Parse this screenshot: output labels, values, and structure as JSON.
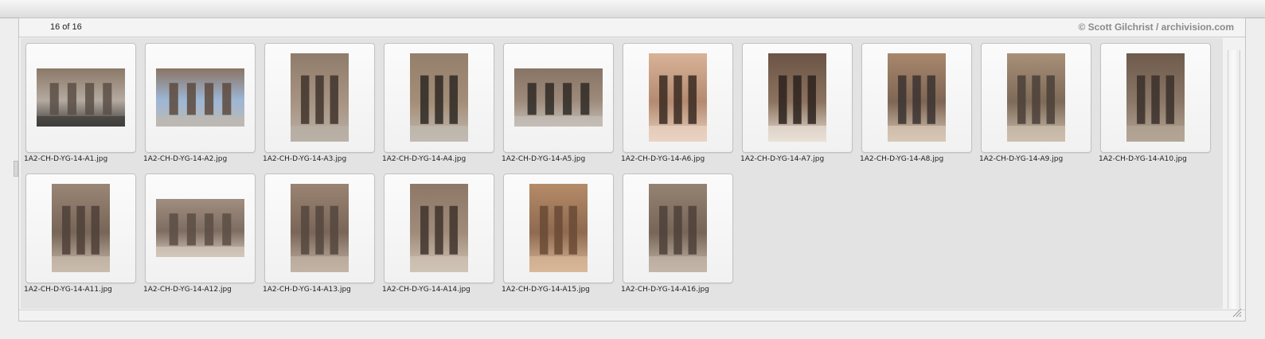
{
  "viewer": {
    "count_label": "16 of 16",
    "credit": "© Scott Gilchrist / archivision.com"
  },
  "thumbnails": [
    {
      "filename": "1A2-CH-D-YG-14-A1.jpg",
      "orientation": "landscape",
      "subject": "stone-stele-sign",
      "colors": [
        "#8b7868",
        "#5a4f47",
        "#3e3d3b",
        "#b4aaa0"
      ]
    },
    {
      "filename": "1A2-CH-D-YG-14-A2.jpg",
      "orientation": "landscape",
      "subject": "cliff-caves-with-visitors",
      "colors": [
        "#8a7464",
        "#5d4a3d",
        "#bdb8b2",
        "#9db7d6"
      ]
    },
    {
      "filename": "1A2-CH-D-YG-14-A3.jpg",
      "orientation": "portrait",
      "subject": "cave-columns",
      "colors": [
        "#8f7c6b",
        "#3f342c",
        "#b9b1a6",
        "#a79382"
      ]
    },
    {
      "filename": "1A2-CH-D-YG-14-A4.jpg",
      "orientation": "portrait",
      "subject": "cave-columns",
      "colors": [
        "#947f6c",
        "#2e2925",
        "#c1bab1",
        "#a48d78"
      ]
    },
    {
      "filename": "1A2-CH-D-YG-14-A5.jpg",
      "orientation": "landscape",
      "subject": "cliff-openings",
      "colors": [
        "#877465",
        "#2f2a26",
        "#c4beb6",
        "#9d8a7a"
      ]
    },
    {
      "filename": "1A2-CH-D-YG-14-A6.jpg",
      "orientation": "portrait",
      "subject": "tall-cave-doorway",
      "colors": [
        "#d8b397",
        "#3a2a22",
        "#e9d3c2",
        "#b48a70"
      ]
    },
    {
      "filename": "1A2-CH-D-YG-14-A7.jpg",
      "orientation": "portrait",
      "subject": "carved-niche-interior",
      "colors": [
        "#6b5446",
        "#2b221d",
        "#e8e0d5",
        "#8c735f"
      ]
    },
    {
      "filename": "1A2-CH-D-YG-14-A8.jpg",
      "orientation": "portrait",
      "subject": "cave-entrance",
      "colors": [
        "#a8876c",
        "#3b3230",
        "#d7c7b5",
        "#7f6654"
      ]
    },
    {
      "filename": "1A2-CH-D-YG-14-A9.jpg",
      "orientation": "portrait",
      "subject": "carved-pillar",
      "colors": [
        "#a89078",
        "#4a3f38",
        "#cdbfae",
        "#7e6a59"
      ]
    },
    {
      "filename": "1A2-CH-D-YG-14-A10.jpg",
      "orientation": "portrait",
      "subject": "carved-pillar-closeup",
      "colors": [
        "#6f5a4c",
        "#3a302a",
        "#b3a595",
        "#8a7767"
      ]
    },
    {
      "filename": "1A2-CH-D-YG-14-A11.jpg",
      "orientation": "portrait",
      "subject": "buddha-relief-niches",
      "colors": [
        "#9a8675",
        "#4e4038",
        "#c9bcad",
        "#776557"
      ]
    },
    {
      "filename": "1A2-CH-D-YG-14-A12.jpg",
      "orientation": "landscape",
      "subject": "relief-frieze",
      "colors": [
        "#a08e80",
        "#5c4d44",
        "#d3c7bb",
        "#7d6c60"
      ]
    },
    {
      "filename": "1A2-CH-D-YG-14-A13.jpg",
      "orientation": "portrait",
      "subject": "relief-wall",
      "colors": [
        "#9a8372",
        "#54463d",
        "#c2b4a5",
        "#7a6658"
      ]
    },
    {
      "filename": "1A2-CH-D-YG-14-A14.jpg",
      "orientation": "portrait",
      "subject": "carved-pagoda-pillar",
      "colors": [
        "#8d7868",
        "#3e342d",
        "#cfc3b5",
        "#a08b79"
      ]
    },
    {
      "filename": "1A2-CH-D-YG-14-A15.jpg",
      "orientation": "portrait",
      "subject": "painted-relief-wall",
      "colors": [
        "#b58b68",
        "#6a4a36",
        "#d8b899",
        "#8f6a50"
      ]
    },
    {
      "filename": "1A2-CH-D-YG-14-A16.jpg",
      "orientation": "portrait",
      "subject": "relief-figures",
      "colors": [
        "#948272",
        "#4d4139",
        "#c3b7aa",
        "#776658"
      ]
    }
  ]
}
